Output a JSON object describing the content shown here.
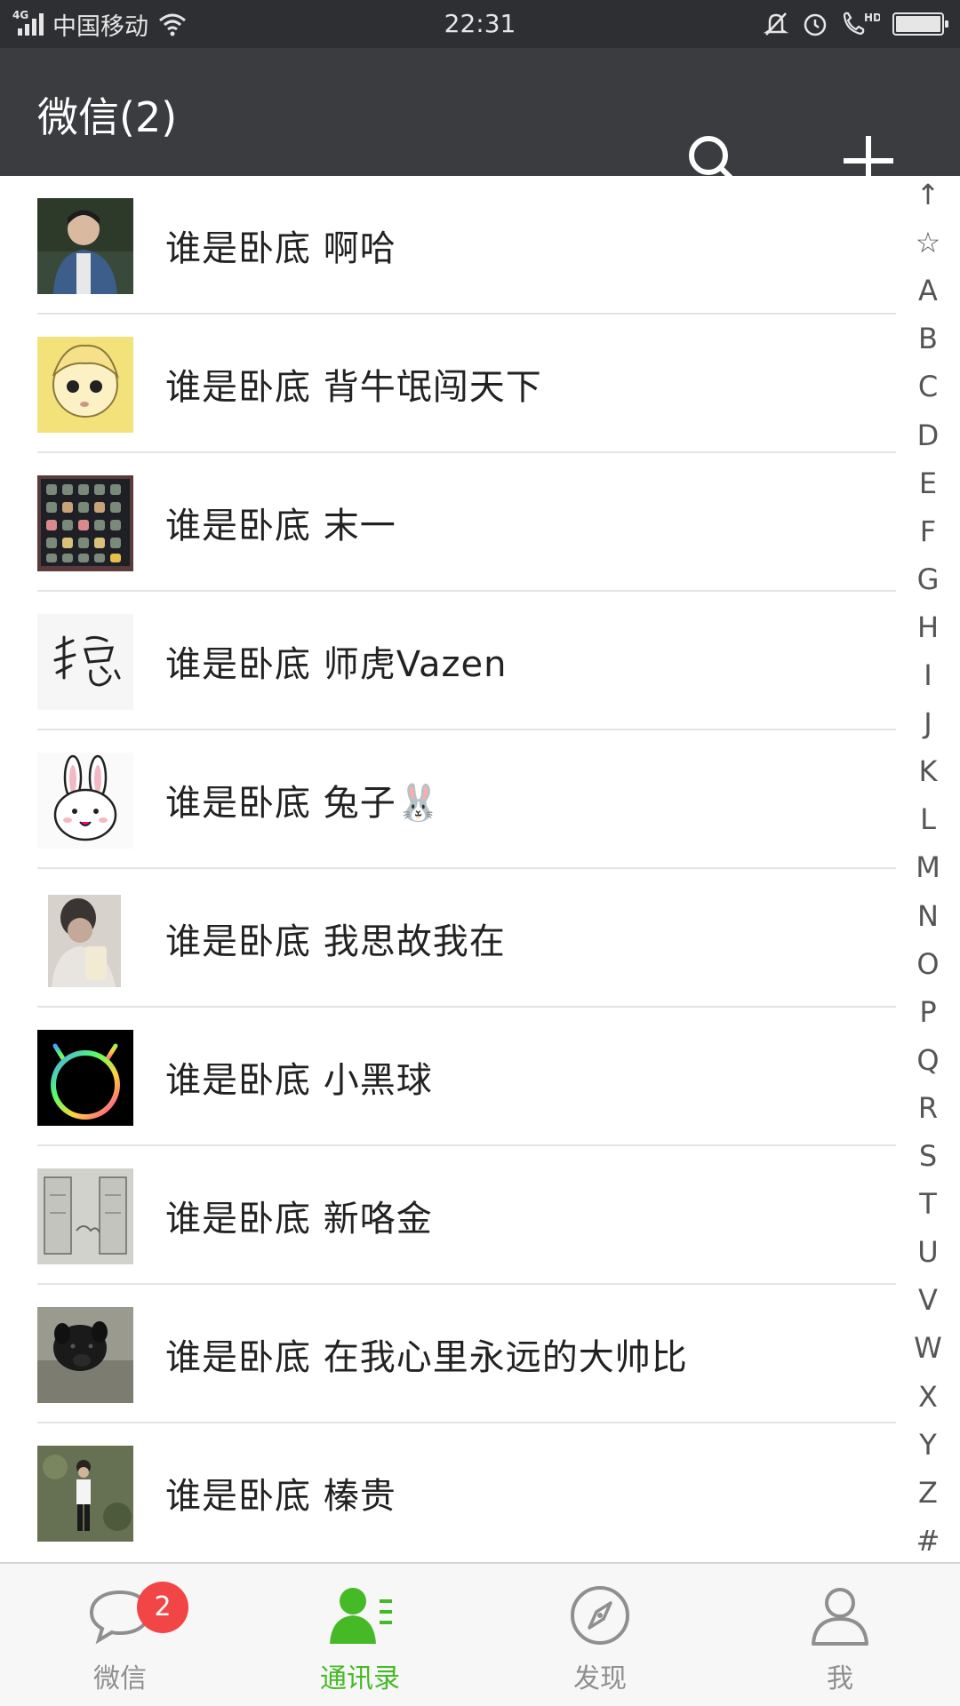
{
  "status_bar": {
    "network": "4G",
    "carrier": "中国移动",
    "time": "22:31",
    "hd": "HD"
  },
  "header": {
    "title": "微信(2)",
    "search_icon": "search-icon",
    "add_icon": "plus-icon"
  },
  "contacts": [
    {
      "name": "谁是卧底  啊哈",
      "avatar": "photo-boy-denim"
    },
    {
      "name": "谁是卧底  背牛氓闯天下",
      "avatar": "anime-boy-yellow"
    },
    {
      "name": "谁是卧底  末一",
      "avatar": "chocolate-box"
    },
    {
      "name": "谁是卧底  师虎Vazen",
      "avatar": "calligraphy"
    },
    {
      "name": "谁是卧底  兔子🐰",
      "avatar": "bunny-cartoon"
    },
    {
      "name": "谁是卧底  我思故我在",
      "avatar": "selfie-phone"
    },
    {
      "name": "谁是卧底  小黑球",
      "avatar": "neon-ring"
    },
    {
      "name": "谁是卧底  新咯金",
      "avatar": "sketch-room"
    },
    {
      "name": "谁是卧底  在我心里永远的大帅比",
      "avatar": "black-puppy"
    },
    {
      "name": "谁是卧底  榛贵",
      "avatar": "girl-garden"
    }
  ],
  "index_bar": [
    "↑",
    "☆",
    "A",
    "B",
    "C",
    "D",
    "E",
    "F",
    "G",
    "H",
    "I",
    "J",
    "K",
    "L",
    "M",
    "N",
    "O",
    "P",
    "Q",
    "R",
    "S",
    "T",
    "U",
    "V",
    "W",
    "X",
    "Y",
    "Z",
    "#"
  ],
  "tabs": [
    {
      "label": "微信",
      "icon": "chat-bubble-icon",
      "badge": "2",
      "active": false
    },
    {
      "label": "通讯录",
      "icon": "contacts-icon",
      "active": true
    },
    {
      "label": "发现",
      "icon": "compass-icon",
      "active": false
    },
    {
      "label": "我",
      "icon": "person-icon",
      "active": false
    }
  ],
  "colors": {
    "header_bg": "#3b3c40",
    "status_bg": "#2e2f33",
    "accent_green": "#46b927",
    "badge_red": "#f24545"
  }
}
